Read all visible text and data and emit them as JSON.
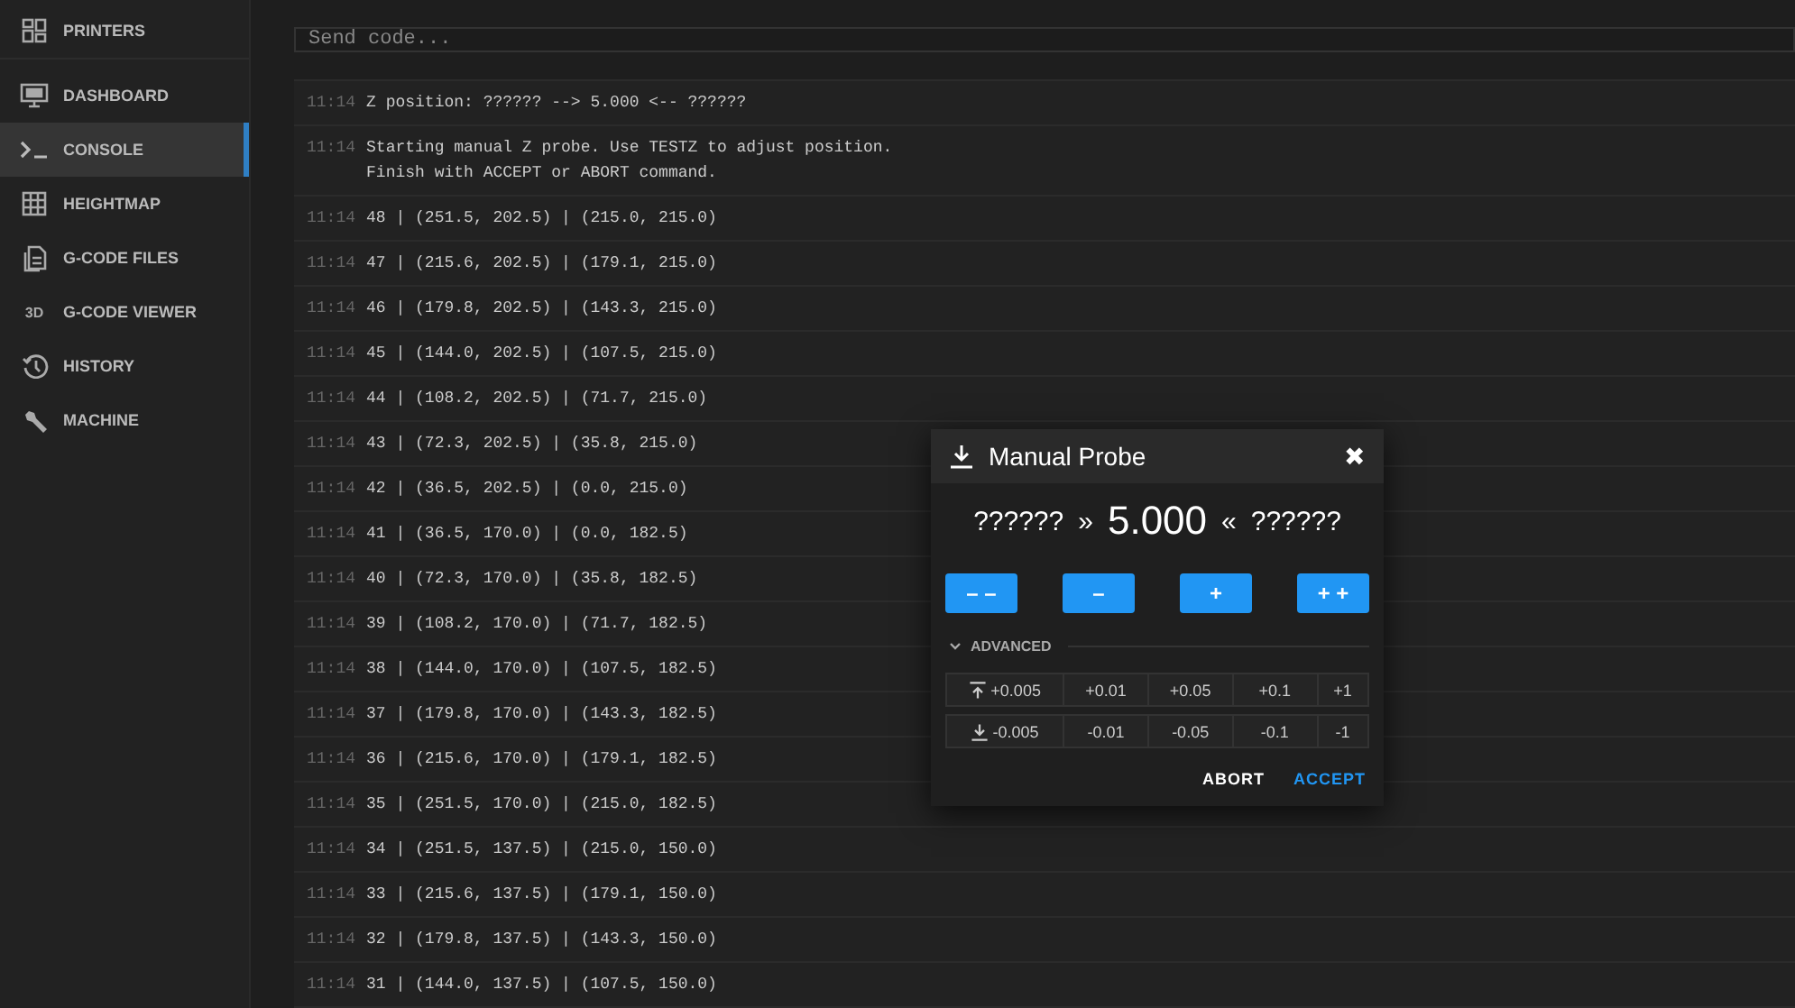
{
  "sidebar": {
    "items": [
      {
        "label": "PRINTERS",
        "selected": false
      },
      {
        "label": "DASHBOARD",
        "selected": false
      },
      {
        "label": "CONSOLE",
        "selected": true
      },
      {
        "label": "HEIGHTMAP",
        "selected": false
      },
      {
        "label": "G-CODE FILES",
        "selected": false
      },
      {
        "label": "G-CODE VIEWER",
        "selected": false
      },
      {
        "label": "HISTORY",
        "selected": false
      },
      {
        "label": "MACHINE",
        "selected": false
      }
    ],
    "badge_3d": "3D"
  },
  "console": {
    "placeholder": "Send code...",
    "rows": [
      {
        "time": "11:14",
        "message": "Z position: ?????? --> 5.000 <-- ??????"
      },
      {
        "time": "11:14",
        "message": "Starting manual Z probe. Use TESTZ to adjust position.\nFinish with ACCEPT or ABORT command."
      },
      {
        "time": "11:14",
        "message": "48 | (251.5, 202.5) | (215.0, 215.0)"
      },
      {
        "time": "11:14",
        "message": "47 | (215.6, 202.5) | (179.1, 215.0)"
      },
      {
        "time": "11:14",
        "message": "46 | (179.8, 202.5) | (143.3, 215.0)"
      },
      {
        "time": "11:14",
        "message": "45 | (144.0, 202.5) | (107.5, 215.0)"
      },
      {
        "time": "11:14",
        "message": "44 | (108.2, 202.5) | (71.7, 215.0)"
      },
      {
        "time": "11:14",
        "message": "43 | (72.3, 202.5) | (35.8, 215.0)"
      },
      {
        "time": "11:14",
        "message": "42 | (36.5, 202.5) | (0.0, 215.0)"
      },
      {
        "time": "11:14",
        "message": "41 | (36.5, 170.0) | (0.0, 182.5)"
      },
      {
        "time": "11:14",
        "message": "40 | (72.3, 170.0) | (35.8, 182.5)"
      },
      {
        "time": "11:14",
        "message": "39 | (108.2, 170.0) | (71.7, 182.5)"
      },
      {
        "time": "11:14",
        "message": "38 | (144.0, 170.0) | (107.5, 182.5)"
      },
      {
        "time": "11:14",
        "message": "37 | (179.8, 170.0) | (143.3, 182.5)"
      },
      {
        "time": "11:14",
        "message": "36 | (215.6, 170.0) | (179.1, 182.5)"
      },
      {
        "time": "11:14",
        "message": "35 | (251.5, 170.0) | (215.0, 182.5)"
      },
      {
        "time": "11:14",
        "message": "34 | (251.5, 137.5) | (215.0, 150.0)"
      },
      {
        "time": "11:14",
        "message": "33 | (215.6, 137.5) | (179.1, 150.0)"
      },
      {
        "time": "11:14",
        "message": "32 | (179.8, 137.5) | (143.3, 150.0)"
      },
      {
        "time": "11:14",
        "message": "31 | (144.0, 137.5) | (107.5, 150.0)"
      }
    ]
  },
  "dialog": {
    "title": "Manual Probe",
    "close": "✖",
    "readout": {
      "left": "??????",
      "left_mark": "»",
      "value": "5.000",
      "right_mark": "«",
      "right": "??????"
    },
    "step_buttons": [
      "– –",
      "–",
      "+",
      "+ +"
    ],
    "advanced": {
      "label": "ADVANCED",
      "expanded": true,
      "rows": [
        {
          "kind": "up",
          "steps": [
            "+0.005",
            "+0.01",
            "+0.05",
            "+0.1",
            "+1"
          ]
        },
        {
          "kind": "down",
          "steps": [
            "-0.005",
            "-0.01",
            "-0.05",
            "-0.1",
            "-1"
          ]
        }
      ]
    },
    "actions": [
      {
        "label": "ABORT",
        "kind": "plain"
      },
      {
        "label": "ACCEPT",
        "kind": "primary"
      }
    ]
  }
}
